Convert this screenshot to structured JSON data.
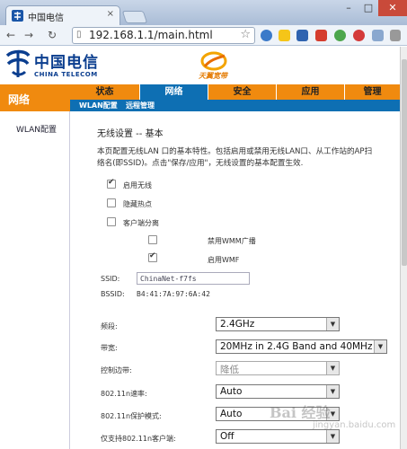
{
  "browser": {
    "tab_title": "中国电信",
    "tab_close": "×",
    "window_controls": {
      "minimize": "–",
      "maximize": "□",
      "close": "✕"
    },
    "back_icon": "←",
    "forward_icon": "→",
    "reload_icon": "↻",
    "address_url": "192.168.1.1/main.html",
    "extensions": [
      "globe-icon",
      "star-icon",
      "ip-icon",
      "abp-icon",
      "green-circle-icon",
      "music-icon",
      "tab-icon",
      "wrench-icon"
    ]
  },
  "router": {
    "logo_cn": "中国电信",
    "logo_en": "CHINA TELECOM",
    "brand_text": "天翼宽带",
    "sidebar_title": "网络",
    "sidebar_items": [
      "WLAN配置"
    ],
    "tabs": [
      "状态",
      "网络",
      "安全",
      "应用",
      "管理"
    ],
    "active_tab": "网络",
    "subtabs": [
      "WLAN配置",
      "远程管理"
    ],
    "colors": {
      "orange": "#f08a0f",
      "blue": "#0e6fb3",
      "logo_blue": "#0b3e8f"
    }
  },
  "wlan": {
    "section_title": "无线设置 -- 基本",
    "desc_line1": "本页配置无线LAN 口的基本特性。包括启用或禁用无线LAN口、从工作站的AP扫",
    "desc_line2": "络名(即SSID)。点击\"保存/应用\"，无线设置的基本配置生效.",
    "checkboxes": [
      {
        "label": "启用无线",
        "checked": true
      },
      {
        "label": "隐藏热点",
        "checked": false
      },
      {
        "label": "客户端分离",
        "checked": false
      },
      {
        "label": "禁用WMM广播",
        "checked": false
      },
      {
        "label": "启用WMF",
        "checked": true
      }
    ],
    "ssid_label": "SSID:",
    "ssid_value": "ChinaNet-f7fs",
    "bssid_label": "BSSID:",
    "bssid_value": "B4:41:7A:97:6A:42",
    "settings": [
      {
        "label": "频段:",
        "value": "2.4GHz",
        "disabled": false
      },
      {
        "label": "带宽:",
        "value": "20MHz in 2.4G Band and 40MHz in 5",
        "disabled": false
      },
      {
        "label": "控制边带:",
        "value": "降低",
        "disabled": true
      },
      {
        "label": "802.11n速率:",
        "value": "Auto",
        "disabled": false
      },
      {
        "label": "802.11n保护模式:",
        "value": "Auto",
        "disabled": false
      },
      {
        "label": "仅支持802.11n客户端:",
        "value": "Off",
        "disabled": false
      }
    ],
    "dropdown_arrow": "▼"
  },
  "watermark": {
    "main": "Bai 经验",
    "sub": "jingyan.baidu.com"
  }
}
